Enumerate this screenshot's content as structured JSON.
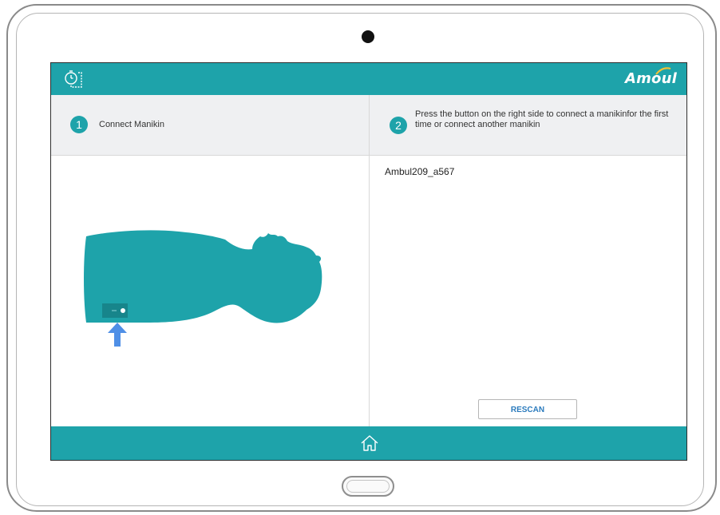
{
  "app": {
    "brand": "Amoul",
    "brand_color": "#1ea3aa",
    "timer_icon": "stopwatch-icon",
    "home_icon": "home-icon"
  },
  "step1": {
    "number": "1",
    "label": "Connect Manikin"
  },
  "step2": {
    "number": "2",
    "label": "Press the button on the right side to connect a manikinfor the first time or connect another manikin"
  },
  "devices": [
    "Ambul209_a567"
  ],
  "actions": {
    "rescan_label": "RESCAN"
  }
}
